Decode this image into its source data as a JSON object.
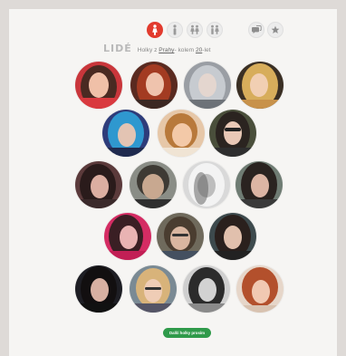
{
  "header": {
    "logo": "LIDÉ",
    "query_prefix": "Holky z",
    "query_city": "Prahy",
    "query_middle": "kolem",
    "query_age": "20",
    "query_suffix": "let"
  },
  "filters": {
    "woman": "woman-icon",
    "man": "man-icon",
    "two_women": "two-women-icon",
    "couple": "couple-icon",
    "chat": "chat-icon",
    "favorites": "star-icon"
  },
  "colors": {
    "accent": "#e23b2e",
    "cta": "#2f9a4a"
  },
  "cta": {
    "label": "Další holky prosím"
  }
}
